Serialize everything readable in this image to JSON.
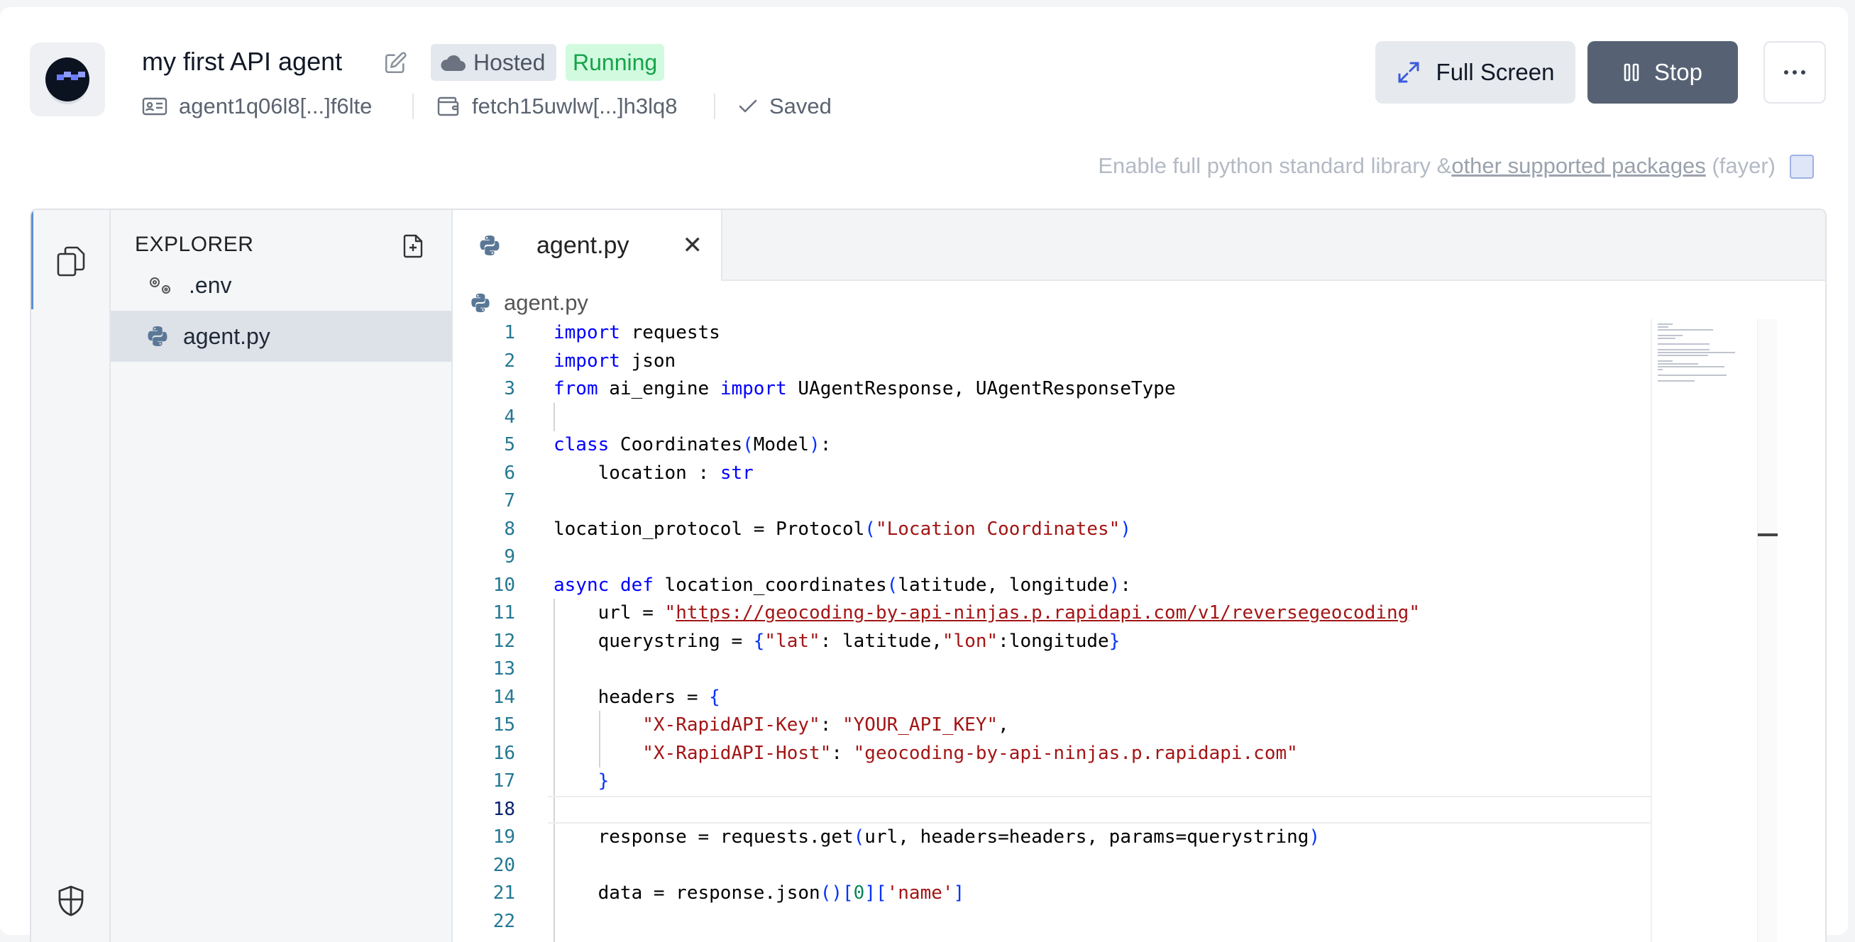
{
  "agent": {
    "title": "my first API agent",
    "hosted_label": "Hosted",
    "status": "Running",
    "address": "agent1q06l8[...]f6lte",
    "wallet": "fetch15uwlw[...]h3lq8",
    "save_state": "Saved"
  },
  "toolbar": {
    "fullscreen_label": "Full Screen",
    "stop_label": "Stop"
  },
  "stdlib": {
    "prefix": "Enable full python standard library &",
    "link": "other supported packages",
    "suffix": "(fayer)"
  },
  "explorer": {
    "title": "EXPLORER",
    "files": [
      ".env",
      "agent.py"
    ]
  },
  "editor": {
    "tab_label": "agent.py",
    "breadcrumb": "agent.py",
    "current_line": 18
  },
  "colors": {
    "running_bg": "#d1fadf",
    "running_fg": "#16a34a",
    "stop_bg": "#566273"
  },
  "code": [
    {
      "n": "1",
      "parts": [
        [
          "kw",
          "import"
        ],
        [
          "",
          " requests"
        ]
      ]
    },
    {
      "n": "2",
      "parts": [
        [
          "kw",
          "import"
        ],
        [
          "",
          " json"
        ]
      ]
    },
    {
      "n": "3",
      "parts": [
        [
          "kw",
          "from"
        ],
        [
          "",
          " ai_engine "
        ],
        [
          "kw",
          "import"
        ],
        [
          "",
          " UAgentResponse, UAgentResponseType"
        ]
      ]
    },
    {
      "n": "4",
      "parts": []
    },
    {
      "n": "5",
      "parts": [
        [
          "kw",
          "class"
        ],
        [
          "",
          " Coordinates"
        ],
        [
          "br",
          "("
        ],
        [
          "",
          "Model"
        ],
        [
          "br",
          ")"
        ],
        [
          "",
          ":"
        ]
      ]
    },
    {
      "n": "6",
      "parts": [
        [
          "",
          "    location : "
        ],
        [
          "typ",
          "str"
        ]
      ]
    },
    {
      "n": "7",
      "parts": []
    },
    {
      "n": "8",
      "parts": [
        [
          "",
          "location_protocol = Protocol"
        ],
        [
          "br",
          "("
        ],
        [
          "str",
          "\"Location Coordinates\""
        ],
        [
          "br",
          ")"
        ]
      ]
    },
    {
      "n": "9",
      "parts": []
    },
    {
      "n": "10",
      "parts": [
        [
          "kw",
          "async"
        ],
        [
          "",
          " "
        ],
        [
          "kw",
          "def"
        ],
        [
          "",
          " location_coordinates"
        ],
        [
          "br",
          "("
        ],
        [
          "",
          "latitude, longitude"
        ],
        [
          "br",
          ")"
        ],
        [
          "",
          ":"
        ]
      ]
    },
    {
      "n": "11",
      "parts": [
        [
          "",
          "    url = "
        ],
        [
          "str",
          "\""
        ],
        [
          "link",
          "https://geocoding-by-api-ninjas.p.rapidapi.com/v1/reversegeocoding"
        ],
        [
          "str",
          "\""
        ]
      ]
    },
    {
      "n": "12",
      "parts": [
        [
          "",
          "    querystring = "
        ],
        [
          "br",
          "{"
        ],
        [
          "str",
          "\"lat\""
        ],
        [
          "",
          ": latitude,"
        ],
        [
          "str",
          "\"lon\""
        ],
        [
          "",
          ":longitude"
        ],
        [
          "br",
          "}"
        ]
      ]
    },
    {
      "n": "13",
      "parts": []
    },
    {
      "n": "14",
      "parts": [
        [
          "",
          "    headers = "
        ],
        [
          "br",
          "{"
        ]
      ]
    },
    {
      "n": "15",
      "parts": [
        [
          "",
          "        "
        ],
        [
          "str",
          "\"X-RapidAPI-Key\""
        ],
        [
          "",
          ": "
        ],
        [
          "str",
          "\"YOUR_API_KEY\""
        ],
        [
          "",
          ","
        ]
      ]
    },
    {
      "n": "16",
      "parts": [
        [
          "",
          "        "
        ],
        [
          "str",
          "\"X-RapidAPI-Host\""
        ],
        [
          "",
          ": "
        ],
        [
          "str",
          "\"geocoding-by-api-ninjas.p.rapidapi.com\""
        ]
      ]
    },
    {
      "n": "17",
      "parts": [
        [
          "",
          "    "
        ],
        [
          "br",
          "}"
        ]
      ]
    },
    {
      "n": "18",
      "parts": []
    },
    {
      "n": "19",
      "parts": [
        [
          "",
          "    response = requests.get"
        ],
        [
          "br",
          "("
        ],
        [
          "",
          "url, headers=headers, params=querystring"
        ],
        [
          "br",
          ")"
        ]
      ]
    },
    {
      "n": "20",
      "parts": []
    },
    {
      "n": "21",
      "parts": [
        [
          "",
          "    data = response.json"
        ],
        [
          "br",
          "()"
        ],
        [
          "br",
          "["
        ],
        [
          "num",
          "0"
        ],
        [
          "br",
          "]"
        ],
        [
          "br",
          "["
        ],
        [
          "str",
          "'name'"
        ],
        [
          "br",
          "]"
        ]
      ]
    },
    {
      "n": "22",
      "parts": []
    }
  ]
}
